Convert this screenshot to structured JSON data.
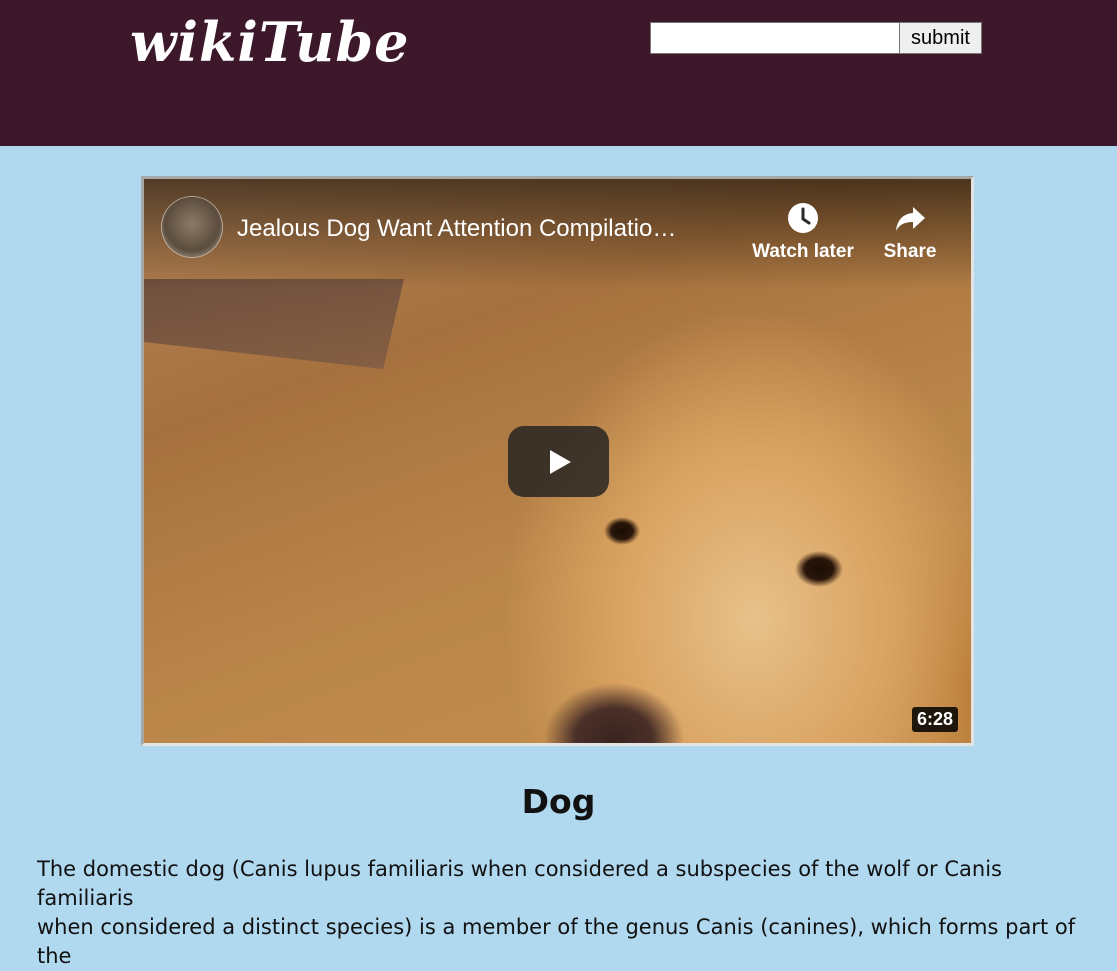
{
  "header": {
    "logo_text": "wikiTube",
    "background_color": "#3d172a",
    "search": {
      "value": "",
      "placeholder": "",
      "submit_label": "submit"
    }
  },
  "video": {
    "title": "Jealous Dog Want Attention Compilatio…",
    "watch_later_label": "Watch later",
    "share_label": "Share",
    "duration": "6:28",
    "icons": [
      "channel-avatar",
      "clock-icon",
      "share-icon",
      "play-icon"
    ]
  },
  "article": {
    "title": "Dog",
    "lines": [
      "The domestic dog (Canis lupus familiaris when considered a subspecies of the wolf or Canis familiaris",
      "when considered a distinct species) is a member of the genus Canis (canines), which forms part of the"
    ]
  },
  "colors": {
    "page_background": "#b0d8ef",
    "header_background": "#3d172a"
  }
}
